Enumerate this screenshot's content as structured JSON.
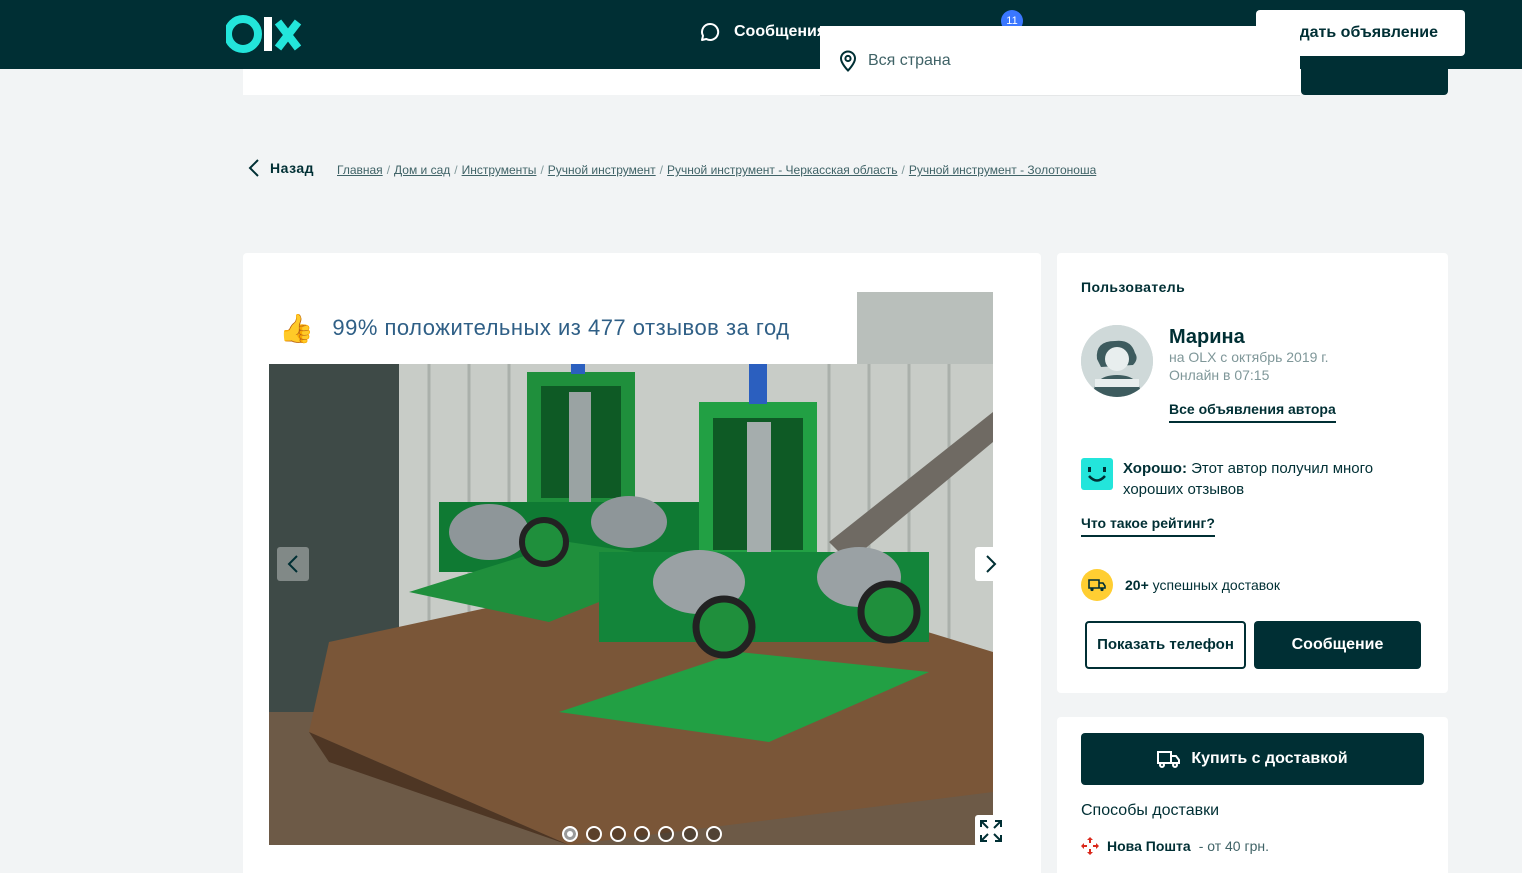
{
  "header": {
    "messages_label": "Сообщения",
    "notification_count": "11",
    "post_ad_label": "Подать объявление"
  },
  "search": {
    "location_value": "Вся страна"
  },
  "breadcrumb": {
    "back_label": "Назад",
    "items": [
      "Главная",
      "Дом и сад",
      "Инструменты",
      "Ручной инструмент",
      "Ручной инструмент - Черкасская область",
      "Ручной инструмент - Золотоноша"
    ]
  },
  "gallery": {
    "review_banner": "99% положительных из 477 отзывов за год",
    "photo_count": 7,
    "active_photo": 1
  },
  "user": {
    "heading": "Пользователь",
    "name": "Марина",
    "member_since": "на OLX с октябрь 2019 г.",
    "online": "Онлайн в 07:15",
    "all_ads_link": "Все объявления автора",
    "rating_label": "Хорошо:",
    "rating_text": "Этот автор получил много хороших отзывов",
    "rating_link": "Что такое рейтинг?",
    "deliveries_count": "20+",
    "deliveries_text": "успешных доставок",
    "show_phone_label": "Показать телефон",
    "message_label": "Сообщение"
  },
  "delivery": {
    "buy_label": "Купить с доставкой",
    "methods_title": "Способы доставки",
    "carrier": "Нова Пошта",
    "carrier_price": "- от 40 грн."
  },
  "colors": {
    "brand_dark": "#002f34",
    "accent_teal": "#23e5db",
    "badge_blue": "#3a77ff",
    "delivery_yellow": "#ffce32",
    "nova_poshta_red": "#da291c"
  }
}
